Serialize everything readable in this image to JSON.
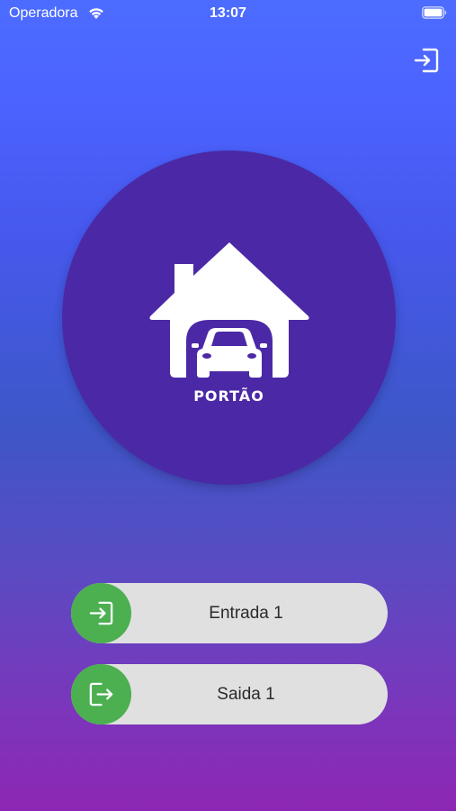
{
  "status_bar": {
    "carrier": "Operadora",
    "time": "13:07",
    "icons": [
      "wifi-icon",
      "battery-icon"
    ]
  },
  "header": {
    "logout_icon": "logout-icon"
  },
  "gate": {
    "label": "PORTÃO",
    "icon": "garage-car-icon"
  },
  "actions": [
    {
      "label": "Entrada 1",
      "icon": "entry-icon"
    },
    {
      "label": "Saida 1",
      "icon": "exit-icon"
    }
  ],
  "colors": {
    "gradient_top": "#4c6cff",
    "gradient_bottom": "#8d27b3",
    "gate_circle": "#4b29a6",
    "knob_green": "#4caf50",
    "slide_track": "#e0e0e0"
  }
}
